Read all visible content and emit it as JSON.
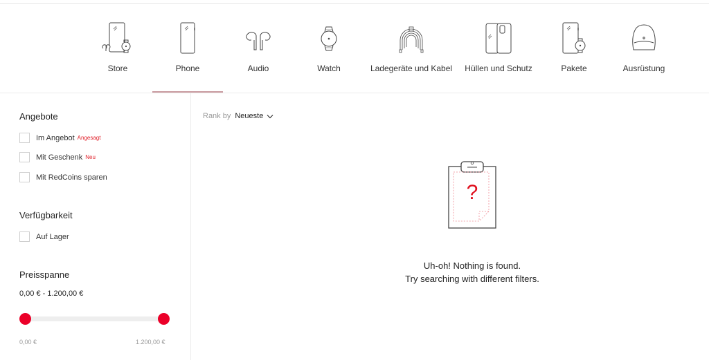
{
  "categories": [
    {
      "label": "Store",
      "icon": "store-devices-icon"
    },
    {
      "label": "Phone",
      "icon": "phone-icon",
      "active": true
    },
    {
      "label": "Audio",
      "icon": "earbuds-icon"
    },
    {
      "label": "Watch",
      "icon": "watch-icon"
    },
    {
      "label": "Ladegeräte und Kabel",
      "icon": "cable-icon"
    },
    {
      "label": "Hüllen und Schutz",
      "icon": "phone-case-icon"
    },
    {
      "label": "Pakete",
      "icon": "bundle-icon"
    },
    {
      "label": "Ausrüstung",
      "icon": "backpack-icon"
    }
  ],
  "filters": {
    "offers": {
      "title": "Angebote",
      "items": [
        {
          "label": "Im Angebot",
          "tag": "Angesagt",
          "checked": false
        },
        {
          "label": "Mit Geschenk",
          "tag": "Neu",
          "checked": false
        },
        {
          "label": "Mit RedCoins sparen",
          "tag": "",
          "checked": false
        }
      ]
    },
    "availability": {
      "title": "Verfügbarkeit",
      "items": [
        {
          "label": "Auf Lager",
          "checked": false
        }
      ]
    },
    "price": {
      "title": "Preisspanne",
      "range_text": "0,00 € - 1.200,00 €",
      "min_label": "0,00 €",
      "max_label": "1.200,00 €",
      "min_value": 0,
      "max_value": 1200,
      "selected_min": 0,
      "selected_max": 1200
    }
  },
  "sort": {
    "label": "Rank by",
    "value": "Neueste"
  },
  "empty_state": {
    "line1": "Uh-oh! Nothing is found.",
    "line2": "Try searching with different filters.",
    "icon": "clipboard-question-icon"
  },
  "colors": {
    "accent": "#eb0029",
    "tag": "#e0202a"
  }
}
